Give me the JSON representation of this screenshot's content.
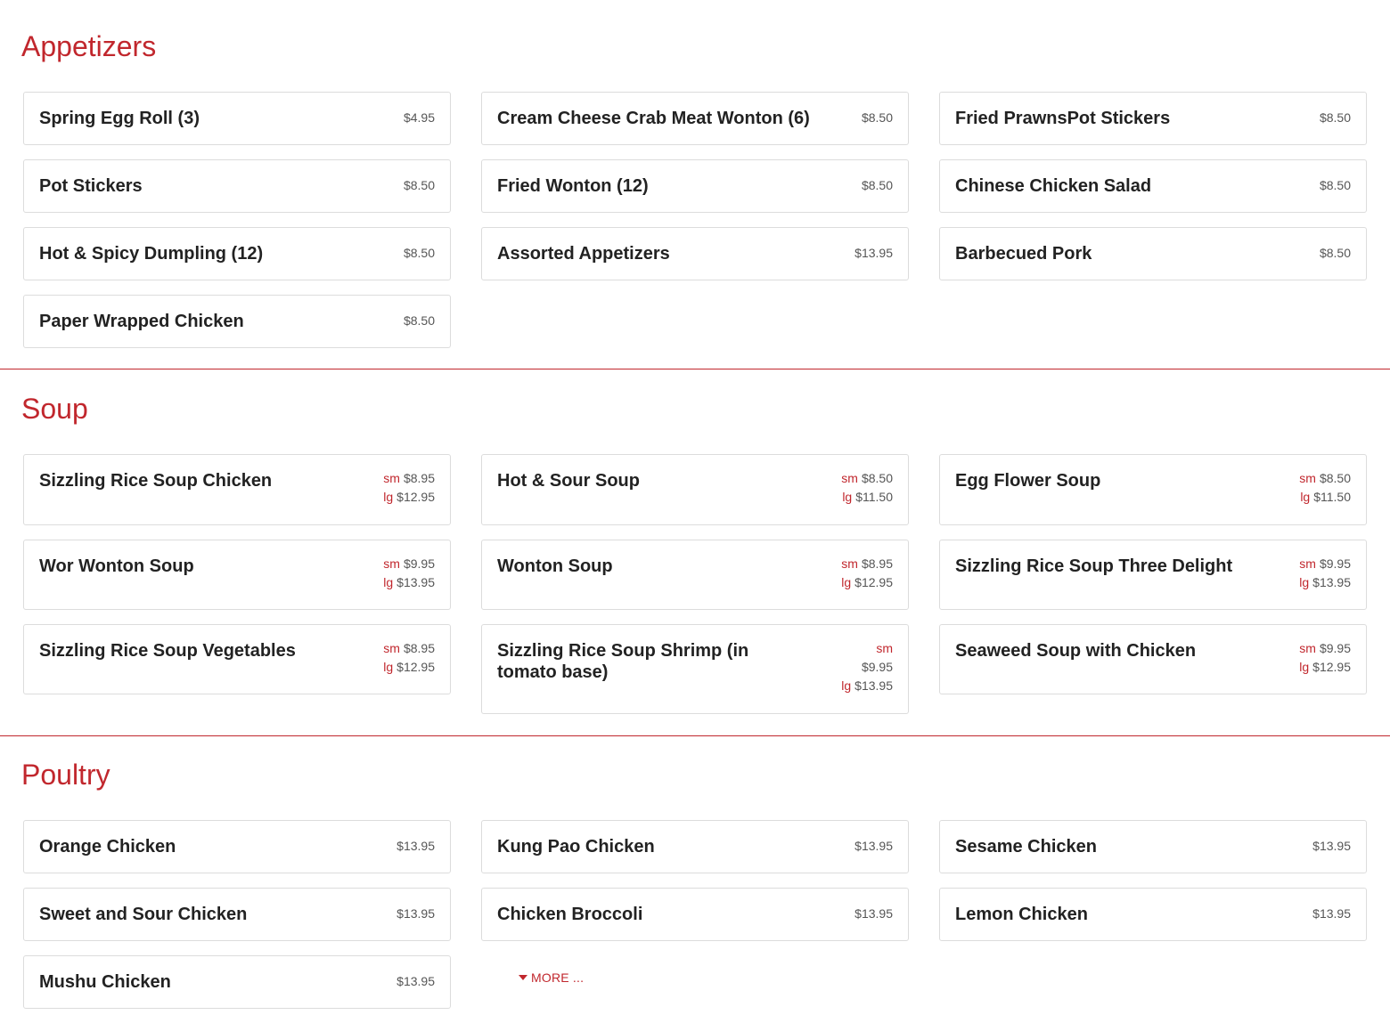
{
  "colors": {
    "accent": "#c1272d",
    "text": "#222222",
    "border": "#dcdcdc"
  },
  "sections": [
    {
      "title": "Appetizers",
      "items": [
        {
          "name": "Spring Egg Roll (3)",
          "price": "$4.95"
        },
        {
          "name": "Cream Cheese Crab Meat Wonton (6)",
          "price": "$8.50"
        },
        {
          "name": "Fried PrawnsPot Stickers",
          "price": "$8.50"
        },
        {
          "name": "Pot Stickers",
          "price": "$8.50"
        },
        {
          "name": "Fried Wonton (12)",
          "price": "$8.50"
        },
        {
          "name": "Chinese Chicken Salad",
          "price": "$8.50"
        },
        {
          "name": "Hot & Spicy Dumpling (12)",
          "price": "$8.50"
        },
        {
          "name": "Assorted Appetizers",
          "price": "$13.95"
        },
        {
          "name": "Barbecued Pork",
          "price": "$8.50"
        },
        {
          "name": "Paper Wrapped Chicken",
          "price": "$8.50"
        }
      ]
    },
    {
      "title": "Soup",
      "size_labels": {
        "small": "sm",
        "large": "lg"
      },
      "items": [
        {
          "name": "Sizzling Rice Soup Chicken",
          "sm": "$8.95",
          "lg": "$12.95"
        },
        {
          "name": "Hot & Sour Soup",
          "sm": "$8.50",
          "lg": "$11.50"
        },
        {
          "name": "Egg Flower Soup",
          "sm": "$8.50",
          "lg": "$11.50"
        },
        {
          "name": "Wor Wonton Soup",
          "sm": "$9.95",
          "lg": "$13.95"
        },
        {
          "name": "Wonton Soup",
          "sm": "$8.95",
          "lg": "$12.95"
        },
        {
          "name": "Sizzling Rice Soup Three Delight",
          "sm": "$9.95",
          "lg": "$13.95"
        },
        {
          "name": "Sizzling Rice Soup Vegetables",
          "sm": "$8.95",
          "lg": "$12.95"
        },
        {
          "name": "Sizzling Rice Soup Shrimp (in tomato base)",
          "sm": "$9.95",
          "lg": "$13.95"
        },
        {
          "name": "Seaweed Soup with Chicken",
          "sm": "$9.95",
          "lg": "$12.95"
        }
      ]
    },
    {
      "title": "Poultry",
      "items": [
        {
          "name": "Orange Chicken",
          "price": "$13.95"
        },
        {
          "name": "Kung Pao Chicken",
          "price": "$13.95"
        },
        {
          "name": "Sesame Chicken",
          "price": "$13.95"
        },
        {
          "name": "Sweet and Sour Chicken",
          "price": "$13.95"
        },
        {
          "name": "Chicken Broccoli",
          "price": "$13.95"
        },
        {
          "name": "Lemon Chicken",
          "price": "$13.95"
        },
        {
          "name": "Mushu Chicken",
          "price": "$13.95"
        }
      ],
      "more_label": "MORE ..."
    }
  ]
}
